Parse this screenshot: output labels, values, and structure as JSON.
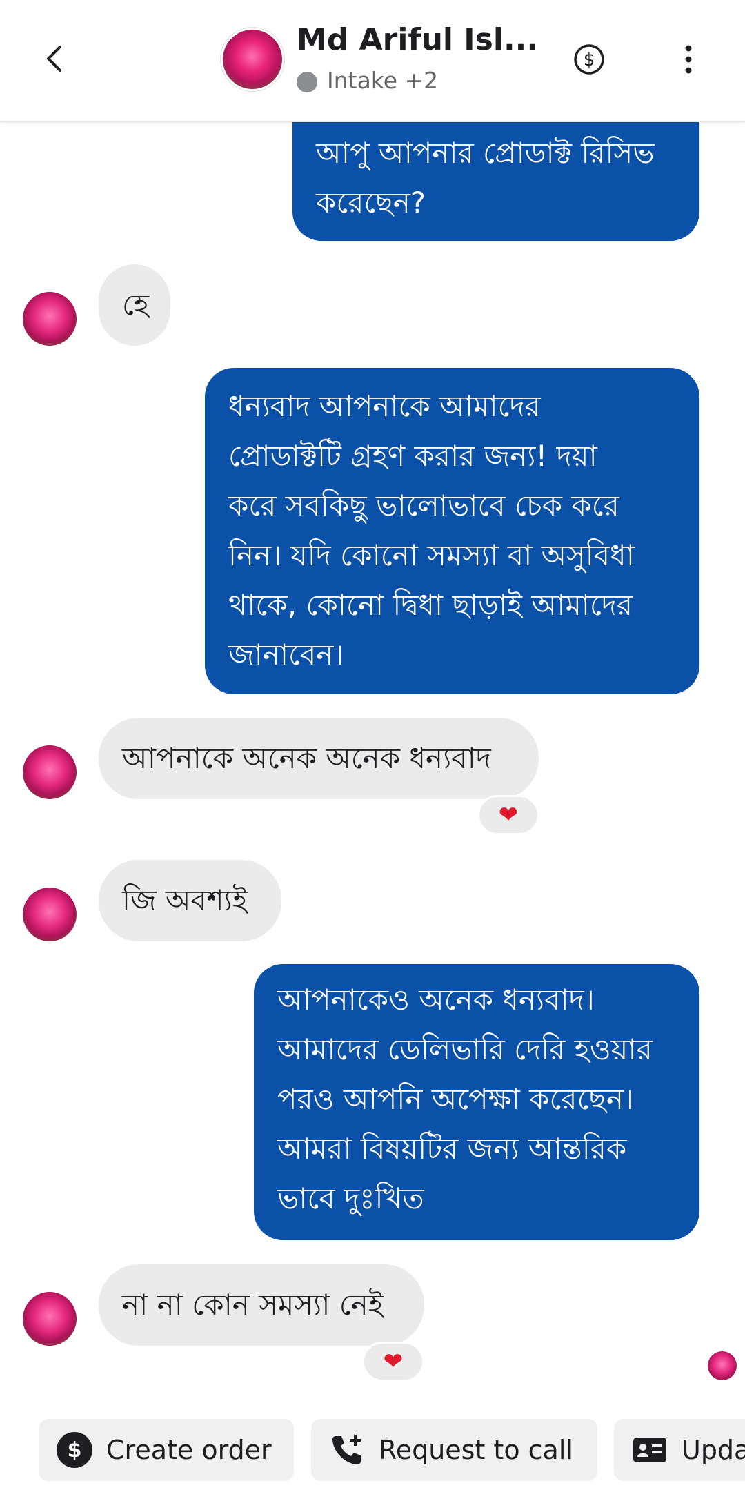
{
  "header": {
    "contact_name": "Md Ariful Isl...",
    "status_label": "Intake +2"
  },
  "messages": [
    {
      "direction": "outgoing",
      "text": "আপু আপনার প্রোডাক্ট রিসিভ\nকরেছেন?"
    },
    {
      "direction": "incoming",
      "text": "হে"
    },
    {
      "direction": "outgoing",
      "text": "ধন্যবাদ আপনাকে আমাদের\nপ্রোডাক্টটি গ্রহণ করার জন্য! দয়া\nকরে সবকিছু ভালোভাবে চেক করে\nনিন। যদি কোনো সমস্যা বা অসুবিধা\nথাকে, কোনো দ্বিধা ছাড়াই আমাদের\nজানাবেন।"
    },
    {
      "direction": "incoming",
      "text": "আপনাকে অনেক অনেক ধন্যবাদ",
      "reaction": "❤"
    },
    {
      "direction": "incoming",
      "text": "জি অবশ্যই"
    },
    {
      "direction": "outgoing",
      "text": "আপনাকেও অনেক ধন্যবাদ।\nআমাদের ডেলিভারি দেরি হওয়ার\nপরও আপনি অপেক্ষা করেছেন।\nআমরা বিষয়টির জন্য আন্তরিক\nভাবে দুঃখিত"
    },
    {
      "direction": "incoming",
      "text": "না না কোন সমস্যা নেই",
      "reaction": "❤"
    }
  ],
  "actions": {
    "create_order": "Create order",
    "request_call": "Request to call",
    "update": "Upda"
  },
  "colors": {
    "outgoing_bubble": "#0a51a7",
    "incoming_bubble": "#ebebeb",
    "reaction_heart": "#e0182d"
  },
  "icons": [
    "back-chevron-icon",
    "dollar-circle-icon",
    "more-vertical-icon",
    "phone-plus-icon",
    "contact-card-icon",
    "heart-icon"
  ]
}
